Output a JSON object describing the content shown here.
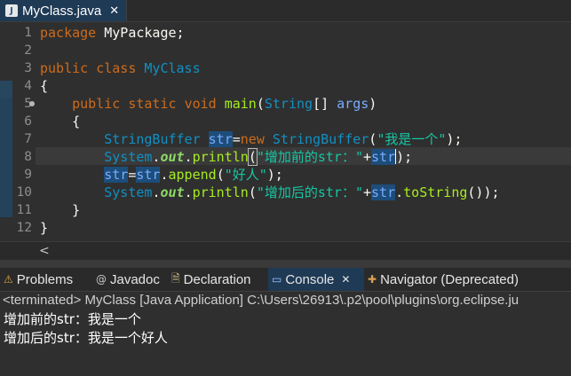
{
  "editor_tab": {
    "file_icon": "java-file-icon",
    "label": "MyClass.java",
    "close": "✕"
  },
  "editor": {
    "line_numbers": [
      "1",
      "2",
      "3",
      "4",
      "5",
      "6",
      "7",
      "8",
      "9",
      "10",
      "11",
      "12"
    ],
    "code": {
      "l1_kw": "package",
      "l1_rest": " MyPackage;",
      "l3_kw1": "public",
      "l3_kw2": "class",
      "l3_name": "MyClass",
      "l4": "{",
      "l5_kw1": "public",
      "l5_kw2": "static",
      "l5_kw3": "void",
      "l5_method": "main",
      "l5_p1": "(",
      "l5_type": "String",
      "l5_p2": "[] ",
      "l5_arg": "args",
      "l5_p3": ")",
      "l6": "{",
      "l7_type": "StringBuffer",
      "l7_var": "str",
      "l7_eq": "=",
      "l7_new": "new",
      "l7_type2": "StringBuffer",
      "l7_p1": "(",
      "l7_str": "\"我是一个\"",
      "l7_p2": ");",
      "l8_sys": "System",
      "l8_dot1": ".",
      "l8_out": "out",
      "l8_dot2": ".",
      "l8_method": "println",
      "l8_paren": "(",
      "l8_str": "\"增加前的str：\"",
      "l8_plus": "+",
      "l8_var": "str",
      "l8_end": ");",
      "l9_var1": "str",
      "l9_eq": "=",
      "l9_var2": "str",
      "l9_dot": ".",
      "l9_method": "append",
      "l9_p1": "(",
      "l9_str": "\"好人\"",
      "l9_p2": ");",
      "l10_sys": "System",
      "l10_dot1": ".",
      "l10_out": "out",
      "l10_dot2": ".",
      "l10_method": "println",
      "l10_p1": "(",
      "l10_str": "\"增加后的str：\"",
      "l10_plus": "+",
      "l10_var": "str",
      "l10_dot3": ".",
      "l10_method2": "toString",
      "l10_end": "());",
      "l11": "}",
      "l12": "}"
    }
  },
  "scrollbar": {
    "left_arrow": "<"
  },
  "views": {
    "tabs": [
      {
        "icon": "problems-icon",
        "glyph": "⚠",
        "label": "Problems"
      },
      {
        "icon": "javadoc-icon",
        "glyph": "@",
        "label": "Javadoc"
      },
      {
        "icon": "declaration-icon",
        "glyph": "🗎",
        "label": "Declaration"
      },
      {
        "icon": "console-icon",
        "glyph": "▭",
        "label": "Console",
        "close": "✕"
      },
      {
        "icon": "navigator-icon",
        "glyph": "✚",
        "label": "Navigator (Deprecated)"
      }
    ]
  },
  "console": {
    "status": "<terminated> MyClass [Java Application] C:\\Users\\26913\\.p2\\pool\\plugins\\org.eclipse.ju",
    "output": [
      "增加前的str：我是一个",
      "增加后的str：我是一个好人"
    ]
  },
  "colors": {
    "background": "#2f2f2f",
    "keyword": "#cc6c1d",
    "type": "#1290c3",
    "method": "#a7ec21",
    "string": "#17c6a3",
    "variable": "#79abff",
    "active_tab": "#1f3a55"
  }
}
